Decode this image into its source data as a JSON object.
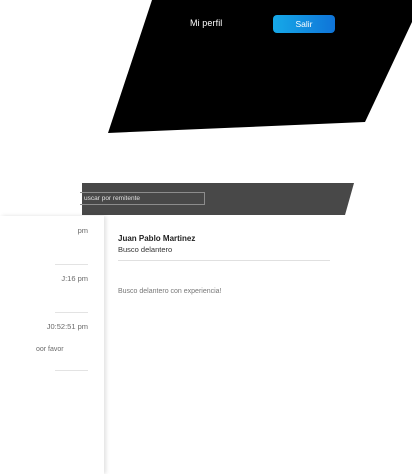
{
  "header": {
    "profile_label": "Mi perfil",
    "logout_label": "Salir"
  },
  "search": {
    "placeholder": "uscar por remitente"
  },
  "message_list": {
    "items": [
      {
        "time": "pm",
        "snippet": ""
      },
      {
        "time": "J:16 pm",
        "snippet": ""
      },
      {
        "time": "J0:52:51 pm",
        "snippet": "oor favor"
      }
    ]
  },
  "detail": {
    "sender": "Juan Pablo Martinez",
    "subject": "Busco delantero",
    "body": "Busco delantero con experiencia!"
  },
  "colors": {
    "header_bg": "#000000",
    "accent_start": "#16a9e8",
    "accent_end": "#0f74d8",
    "search_band": "#484848"
  }
}
